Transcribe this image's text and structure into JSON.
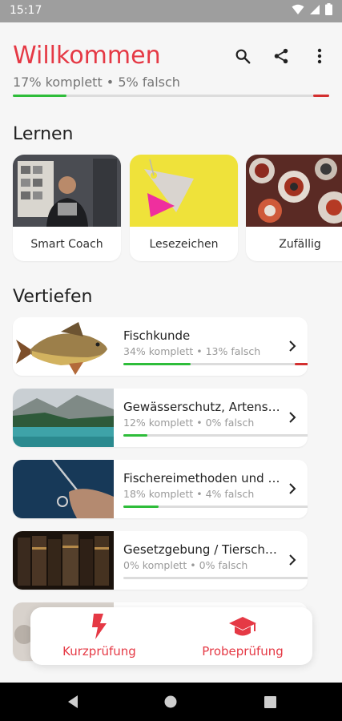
{
  "status_bar": {
    "time": "15:17"
  },
  "header": {
    "title": "Willkommen",
    "subtitle": "17% komplett • 5% falsch",
    "progress": {
      "complete": 0.17,
      "wrong": 0.05
    }
  },
  "learn": {
    "title": "Lernen",
    "cards": [
      {
        "label": "Smart Coach"
      },
      {
        "label": "Lesezeichen"
      },
      {
        "label": "Zufällig"
      }
    ]
  },
  "deepen": {
    "title": "Vertiefen",
    "topics": [
      {
        "title": "Fischkunde",
        "sub": "34% komplett • 13% falsch",
        "complete": 0.34,
        "wrong": 0.13
      },
      {
        "title": "Gewässerschutz, Artenschutz, ...",
        "sub": "12% komplett • 0% falsch",
        "complete": 0.12,
        "wrong": 0
      },
      {
        "title": "Fischereimethoden und -geräte",
        "sub": "18% komplett • 4% falsch",
        "complete": 0.18,
        "wrong": 0.04
      },
      {
        "title": "Gesetzgebung / Tierschutz",
        "sub": "0% komplett • 0% falsch",
        "complete": 0,
        "wrong": 0
      }
    ]
  },
  "bottom_actions": {
    "quick": {
      "label": "Kurzprüfung",
      "icon": "lightning-icon"
    },
    "practice": {
      "label": "Probeprüfung",
      "icon": "graduation-cap-icon"
    }
  },
  "colors": {
    "accent": "#e53945",
    "ok": "#2ebd3a",
    "wrong": "#d32f2f"
  }
}
